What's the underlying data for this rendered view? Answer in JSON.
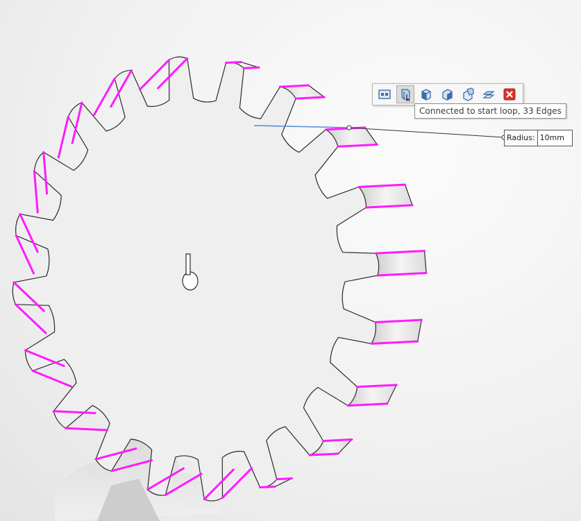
{
  "colors": {
    "edge_highlight": "#ff1aff",
    "preview_edge": "#5a8fd6",
    "gear_face": "#f0efef",
    "gear_outline": "#2a2a2a"
  },
  "toolbar": {
    "buttons": [
      {
        "icon": "select-loop-icon",
        "active": false
      },
      {
        "icon": "connected-to-start-loop-icon",
        "active": true
      },
      {
        "icon": "connected-to-start-face-icon",
        "active": false
      },
      {
        "icon": "connected-to-end-face-icon",
        "active": false
      },
      {
        "icon": "connected-features-icon",
        "active": false
      },
      {
        "icon": "feature-edges-icon",
        "active": false
      },
      {
        "icon": "close-icon",
        "active": false
      }
    ]
  },
  "tooltip": {
    "text": "Connected to start loop, 33 Edges"
  },
  "callout": {
    "label": "Radius:",
    "value": "10mm"
  }
}
